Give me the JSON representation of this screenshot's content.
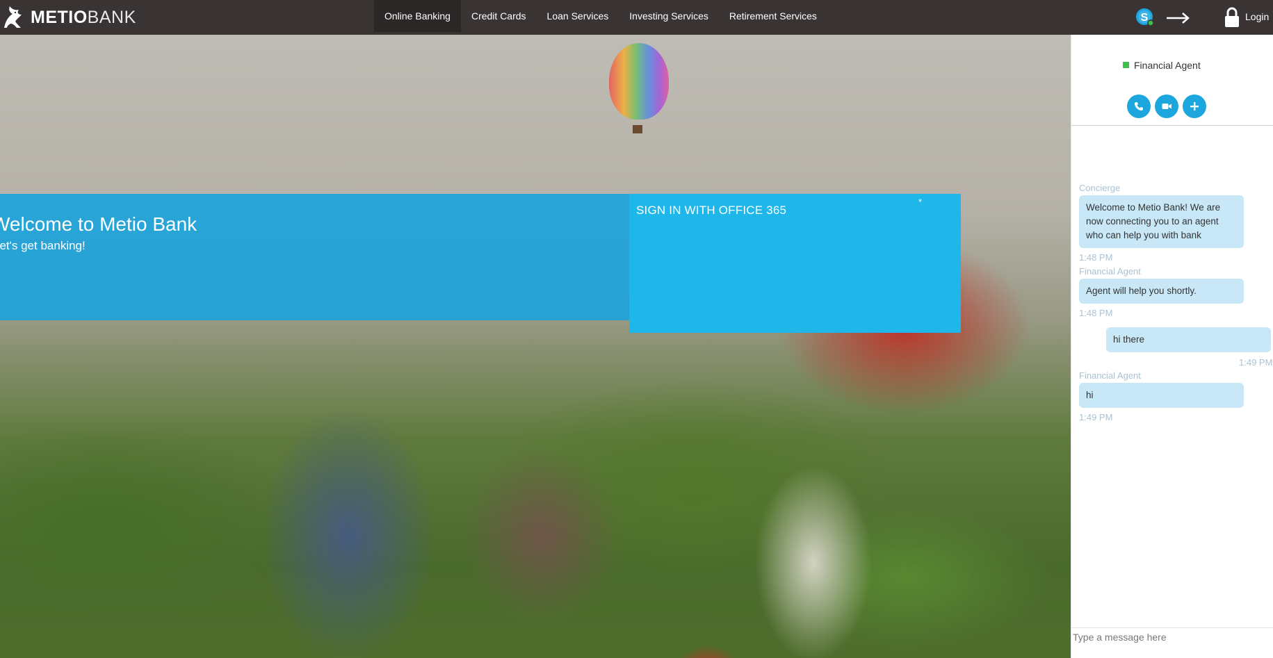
{
  "brand": {
    "name_bold": "METIO",
    "name_light": "BANK",
    "logo_icon": "griffin-logo-icon"
  },
  "nav": {
    "items": [
      {
        "label": "Online Banking",
        "active": true
      },
      {
        "label": "Credit Cards",
        "active": false
      },
      {
        "label": "Loan Services",
        "active": false
      },
      {
        "label": "Investing Services",
        "active": false
      },
      {
        "label": "Retirement Services",
        "active": false
      }
    ],
    "login_label": "Login",
    "icons": [
      "skype-icon",
      "arrow-right-icon",
      "lock-icon"
    ]
  },
  "hero": {
    "welcome_title": "Welcome to Metio Bank",
    "welcome_subtitle": "Let's get banking!",
    "signin_title": "SIGN IN WITH OFFICE 365",
    "signin_star": "*"
  },
  "chat": {
    "agent_name": "Financial Agent",
    "agent_status_color": "#3cc24a",
    "actions": [
      "phone-icon",
      "video-icon",
      "plus-icon"
    ],
    "messages": [
      {
        "sender": "Concierge",
        "text": "Welcome to Metio Bank! We are now connecting you to an agent who can help you with bank",
        "time": "1:48 PM",
        "outgoing": false
      },
      {
        "sender": "Financial Agent",
        "text": "Agent will help you shortly.",
        "time": "1:48 PM",
        "outgoing": false
      },
      {
        "sender": "",
        "text": "hi there",
        "time": "1:49 PM",
        "outgoing": true
      },
      {
        "sender": "Financial Agent",
        "text": "hi",
        "time": "1:49 PM",
        "outgoing": false
      }
    ],
    "input_placeholder": "Type a message here"
  },
  "colors": {
    "topbar": "#393433",
    "welcome_band": "#1da3db",
    "signin_panel": "#1fb6ea",
    "chat_accent": "#1ca6dd",
    "bubble": "#c8e8f7"
  }
}
